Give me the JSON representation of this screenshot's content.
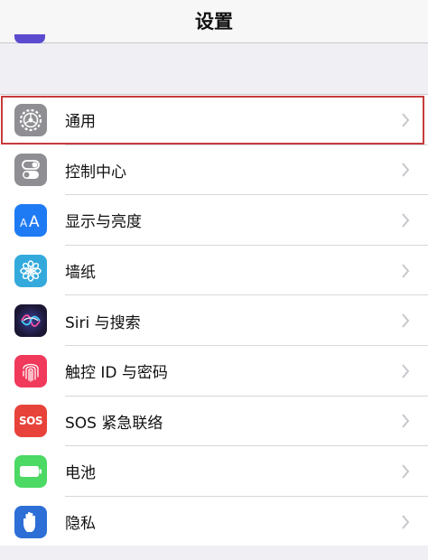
{
  "nav": {
    "title": "设置"
  },
  "settings": {
    "items": [
      {
        "label": "通用",
        "icon": "gear-icon",
        "color": "#8e8e93",
        "selected": true
      },
      {
        "label": "控制中心",
        "icon": "toggle-icon",
        "color": "#8e8e93"
      },
      {
        "label": "显示与亮度",
        "icon": "display-aa-icon",
        "color": "#1e7bf4"
      },
      {
        "label": "墙纸",
        "icon": "wallpaper-flower-icon",
        "color": "#34aadc"
      },
      {
        "label": "Siri 与搜索",
        "icon": "siri-icon",
        "color": "#2a2250"
      },
      {
        "label": "触控 ID 与密码",
        "icon": "fingerprint-icon",
        "color": "#f0395b"
      },
      {
        "label": "SOS 紧急联络",
        "icon": "sos-icon",
        "color": "#e8433a",
        "icon_text": "SOS"
      },
      {
        "label": "电池",
        "icon": "battery-icon",
        "color": "#4cd964"
      },
      {
        "label": "隐私",
        "icon": "hand-icon",
        "color": "#2d6fd6"
      }
    ]
  }
}
